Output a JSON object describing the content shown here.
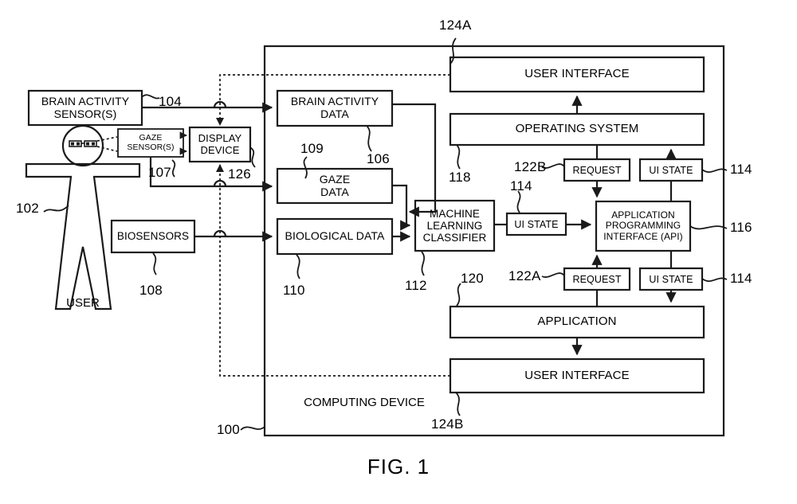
{
  "figure": {
    "caption": "FIG. 1",
    "container_label": "COMPUTING DEVICE",
    "user_label": "USER"
  },
  "sensor_blocks": [
    {
      "id": "brain-activity-sensors",
      "label": "BRAIN ACTIVITY\nSENSOR(S)",
      "ref": "104"
    },
    {
      "id": "gaze-sensors",
      "label": "GAZE\nSENSOR(S)",
      "ref": "107"
    },
    {
      "id": "display-device",
      "label": "DISPLAY\nDEVICE",
      "ref": "126"
    },
    {
      "id": "biosensors",
      "label": "BIOSENSORS",
      "ref": "108"
    }
  ],
  "data_blocks": [
    {
      "id": "brain-activity-data",
      "label": "BRAIN ACTIVITY\nDATA",
      "ref": "106"
    },
    {
      "id": "gaze-data",
      "label": "GAZE\nDATA",
      "ref": "109"
    },
    {
      "id": "biological-data",
      "label": "BIOLOGICAL DATA",
      "ref": "110"
    }
  ],
  "processing_blocks": [
    {
      "id": "machine-learning-classifier",
      "label": "MACHINE\nLEARNING\nCLASSIFIER",
      "ref": "112"
    },
    {
      "id": "api",
      "label": "APPLICATION\nPROGRAMMING\nINTERFACE (API)",
      "ref": "116"
    }
  ],
  "stack_blocks": [
    {
      "id": "user-interface-top",
      "label": "USER INTERFACE",
      "ref": "124A"
    },
    {
      "id": "operating-system",
      "label": "OPERATING SYSTEM",
      "ref": "118"
    },
    {
      "id": "application",
      "label": "APPLICATION",
      "ref": "120"
    },
    {
      "id": "user-interface-bottom",
      "label": "USER INTERFACE",
      "ref": "124B"
    }
  ],
  "signal_blocks": [
    {
      "id": "ui-state-classifier-out",
      "label": "UI STATE",
      "ref": "114"
    },
    {
      "id": "request-os",
      "label": "REQUEST",
      "ref": "122B"
    },
    {
      "id": "ui-state-os",
      "label": "UI STATE",
      "ref": "114"
    },
    {
      "id": "request-app",
      "label": "REQUEST",
      "ref": "122A"
    },
    {
      "id": "ui-state-app",
      "label": "UI STATE",
      "ref": "114"
    }
  ],
  "reference_numerals": {
    "user": "102",
    "brain_activity_sensors": "104",
    "brain_activity_data": "106",
    "gaze_sensors": "107",
    "biosensors": "108",
    "gaze_data": "109",
    "biological_data": "110",
    "machine_learning_classifier": "112",
    "ui_state_classifier": "114",
    "ui_state_os": "114",
    "ui_state_app": "114",
    "api": "116",
    "operating_system": "118",
    "application": "120",
    "request_app": "122A",
    "request_os": "122B",
    "user_interface_top": "124A",
    "user_interface_bottom": "124B",
    "display_device": "126",
    "computing_device": "100"
  },
  "colors": {
    "line": "#1a1a1a",
    "background": "#ffffff",
    "text": "#000000"
  }
}
